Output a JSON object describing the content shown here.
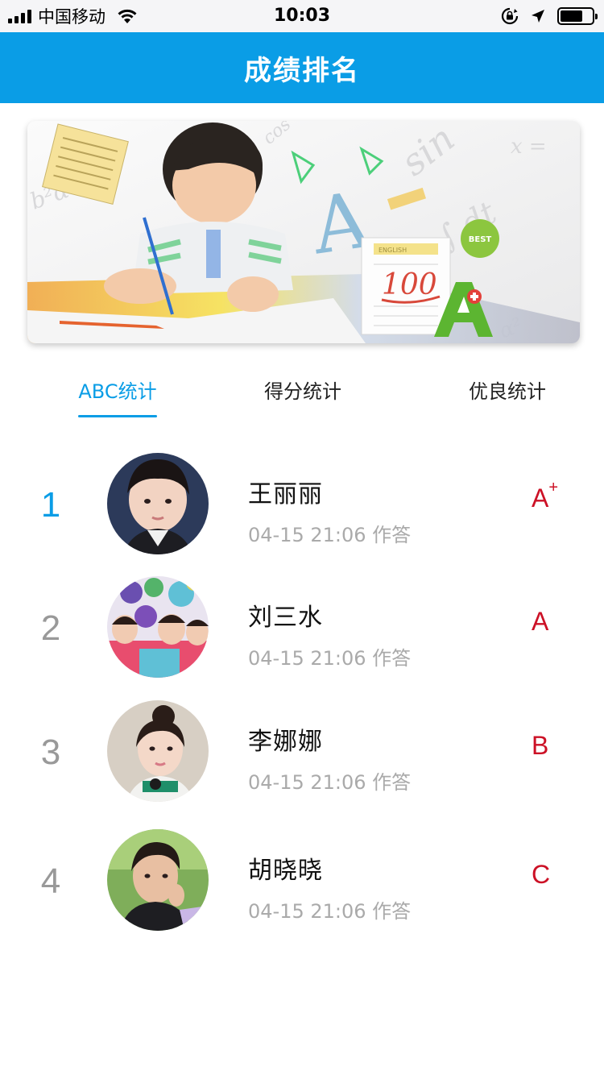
{
  "status_bar": {
    "carrier": "中国移动",
    "time": "10:03",
    "battery_level": 0.72
  },
  "header": {
    "title": "成绩排名"
  },
  "banner": {
    "paper_label": "ENGLISH",
    "score_text": "100",
    "badge_text": "BEST",
    "letter_a": "A",
    "logo_text": "sin"
  },
  "tabs": [
    {
      "label": "ABC统计",
      "active": true
    },
    {
      "label": "得分统计",
      "active": false
    },
    {
      "label": "优良统计",
      "active": false
    }
  ],
  "rankings": [
    {
      "rank": "1",
      "name": "王丽丽",
      "time": "04-15 21:06 作答",
      "grade": "A",
      "grade_suffix": "+"
    },
    {
      "rank": "2",
      "name": "刘三水",
      "time": "04-15 21:06 作答",
      "grade": "A",
      "grade_suffix": ""
    },
    {
      "rank": "3",
      "name": "李娜娜",
      "time": "04-15 21:06 作答",
      "grade": "B",
      "grade_suffix": ""
    },
    {
      "rank": "4",
      "name": "胡晓晓",
      "time": "04-15 21:06 作答",
      "grade": "C",
      "grade_suffix": ""
    }
  ],
  "colors": {
    "accent": "#0a9de6",
    "grade_red": "#cc1126",
    "muted": "#999999"
  }
}
